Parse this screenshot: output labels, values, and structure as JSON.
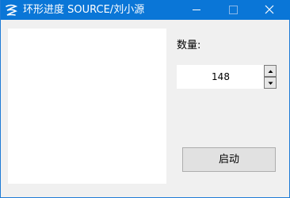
{
  "window": {
    "title": "环形进度 SOURCE/刘小源",
    "icons": {
      "app": "app-swirl-icon",
      "minimize": "minimize-icon",
      "maximize": "maximize-icon",
      "close": "close-icon"
    }
  },
  "quantity": {
    "label": "数量:",
    "value": "148",
    "up_icon": "arrow-up-icon",
    "down_icon": "arrow-down-icon"
  },
  "start_button": {
    "label": "启动"
  },
  "colors": {
    "titlebar": "#0a76d7",
    "window_bg": "#f0f0f0",
    "panel_bg": "#ffffff",
    "button_bg": "#e1e1e1"
  }
}
